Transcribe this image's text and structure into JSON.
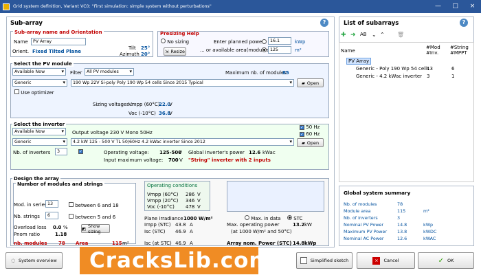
{
  "window": {
    "title": "Grid system definition, Variant VC0:  \"First simulation: simple system without perturbations\""
  },
  "subarray": {
    "header": "Sub-array",
    "name_section": "Sub-array name and Orientation",
    "name_label": "Name",
    "name_value": "PV Array",
    "orient_label": "Orient.",
    "orient_value": "Fixed Tilted Plane",
    "tilt_label": "Tilt",
    "tilt_value": "25°",
    "azimuth_label": "Azimuth",
    "azimuth_value": "20°"
  },
  "presizing": {
    "title": "Presizing Help",
    "no_sizing": "No sizing",
    "resize": "Resize",
    "planned_label": "Enter planned power",
    "planned_value": "16.1",
    "planned_unit": "kWp",
    "area_label": "... or available area(modules)",
    "area_value": "125",
    "area_unit": "m²"
  },
  "pv": {
    "title": "Select the PV module",
    "available": "Available Now",
    "filter": "Filter",
    "filter_value": "All PV modules",
    "max_label": "Maximum nb. of modules",
    "max_value": "85",
    "maker": "Generic",
    "module": "190 Wp 22V      Si-poly      Poly 190 Wp  54 cells         Since 2015                    Typical",
    "open": "Open",
    "use_optimizer": "Use optimizer",
    "sizing_label": "Sizing voltages :",
    "vmpp_label": "Vmpp (60°C)",
    "vmpp_value": "22.0",
    "voc_label": "Voc (-10°C)",
    "voc_value": "36.8",
    "unit_v": "V"
  },
  "inverter": {
    "title": "Select the inverter",
    "available": "Available Now",
    "output": "Output voltage 230 V Mono 50Hz",
    "hz50": "50 Hz",
    "hz60": "60 Hz",
    "maker": "Generic",
    "model": "4.2 kW      125 - 500 V    TL        50/60Hz      4.2 kWac inverter                                   Since 2012",
    "open": "Open",
    "nb_label": "Nb. of inverters",
    "nb_value": "3",
    "op_label": "Operating voltage:",
    "op_value": "125-500",
    "op_unit": "V",
    "global_label": "Global Inverter's power",
    "global_value": "12.6",
    "global_unit": "kWac",
    "input_label": "Input maximum voltage:",
    "input_value": "700",
    "input_unit": "V",
    "string_note": "\"String\" inverter with 2 inputs"
  },
  "design": {
    "title": "Design the array",
    "modules_title": "Number of modules and strings",
    "mod_series_label": "Mod. in series",
    "mod_series_value": "13",
    "between_series": "between 6 and 18",
    "strings_label": "Nb. strings",
    "strings_value": "6",
    "between_strings": "between 5 and 6",
    "overload_label": "Overload loss",
    "overload_value": "0.0",
    "overload_unit": "%",
    "pnom_label": "Pnom ratio",
    "pnom_value": "1.18",
    "show_sizing": "Show sizing",
    "nb_modules_label": "nb. modules",
    "nb_modules_value": "78",
    "area_label": "Area",
    "area_value": "115",
    "area_unit": "m²"
  },
  "operating": {
    "title": "Operating conditions",
    "vmpp60": "Vmpp (60°C)",
    "vmpp60_value": "286",
    "vmpp20": "Vmpp (20°C)",
    "vmpp20_value": "346",
    "voc10": "Voc (-10°C)",
    "voc10_value": "478",
    "unit": "V",
    "irr_label": "Plane irradiance",
    "irr_value": "1000 W/m²",
    "max_data": "Max. in data",
    "stc": "STC",
    "impp_label": "Impp (STC)",
    "impp_value": "43.8",
    "isc_label": "Isc (STC)",
    "isc_value": "46.9",
    "unit_a": "A",
    "max_power_label": "Max. operating power",
    "max_power_value": "13.2",
    "max_power_unit": "kW",
    "at_label": "(at 1000 W/m² and 50°C)",
    "isc_stc_label": "Isc (at STC)",
    "isc_stc_value": "46.9",
    "array_label": "Array nom. Power (STC)",
    "array_value": "14.8",
    "array_unit": "kWp"
  },
  "list": {
    "title": "List of subarrays",
    "col_name": "Name",
    "col_mod": "#Mod\n#Inv.",
    "col_string": "#String\n#MPPT",
    "root": "PV Array",
    "row1": "Generic - Poly 190 Wp  54 cells",
    "row1_mod": "13",
    "row1_string": "6",
    "row2": "Generic - 4.2 kWac inverter",
    "row2_mod": "3",
    "row2_string": "1"
  },
  "summary": {
    "title": "Global system summary",
    "rows": [
      [
        "Nb. of modules",
        "78",
        ""
      ],
      [
        "Module area",
        "115",
        "m²"
      ],
      [
        "Nb. of inverters",
        "3",
        ""
      ],
      [
        "Nominal PV Power",
        "14.8",
        "kWp"
      ],
      [
        "Maximum PV Power",
        "13.8",
        "kWDC"
      ],
      [
        "Nominal AC Power",
        "12.6",
        "kWAC"
      ]
    ]
  },
  "bottom": {
    "system_overview": "System overview",
    "simplified": "Simplified sketch",
    "cancel": "Cancel",
    "ok": "OK",
    "watermark": "CracksLib.com"
  }
}
